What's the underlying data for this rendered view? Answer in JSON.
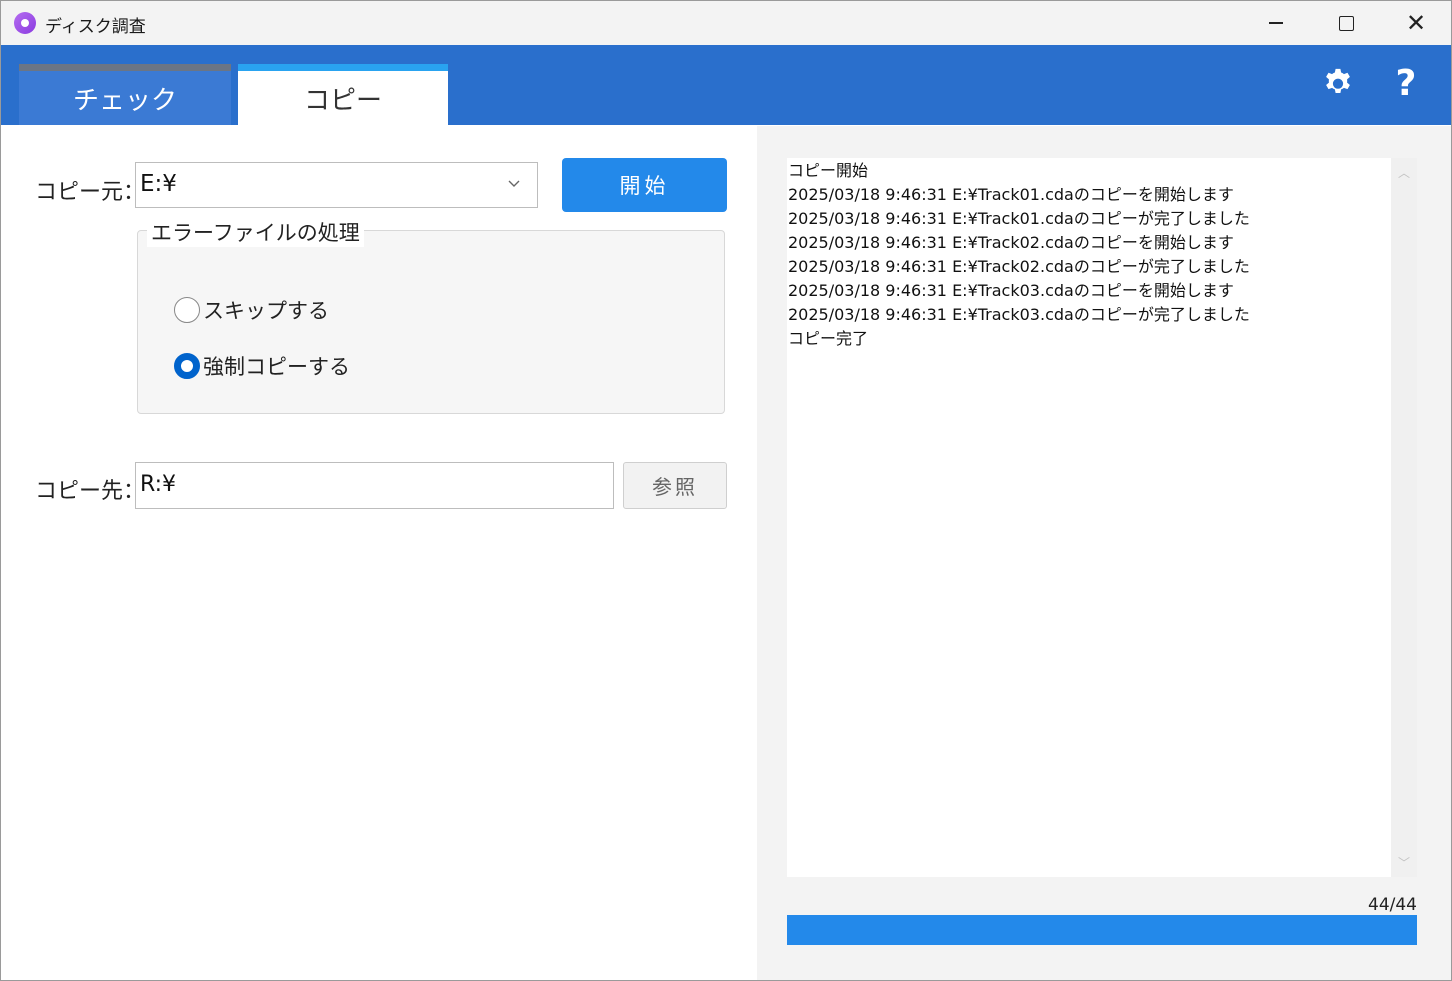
{
  "window": {
    "title": "ディスク調査",
    "icon": "app-disc-icon",
    "controls": [
      "minimize-icon",
      "maximize-icon",
      "close-icon"
    ]
  },
  "tabs": [
    {
      "label": "チェック",
      "active": false
    },
    {
      "label": "コピー",
      "active": true
    }
  ],
  "header_icons": {
    "settings": "gear-icon",
    "help_label": "?"
  },
  "copy": {
    "source_label": "コピー元：",
    "source_value": "E:¥",
    "start_button": "開始",
    "error_group_title": "エラーファイルの処理",
    "options": [
      {
        "label": "スキップする",
        "selected": false
      },
      {
        "label": "強制コピーする",
        "selected": true
      }
    ],
    "dest_label": "コピー先：",
    "dest_value": "R:¥",
    "browse_button": "参照"
  },
  "log": {
    "lines": [
      "コピー開始",
      "2025/03/18 9:46:31 E:¥Track01.cdaのコピーを開始します",
      "2025/03/18 9:46:31 E:¥Track01.cdaのコピーが完了しました",
      "2025/03/18 9:46:31 E:¥Track02.cdaのコピーを開始します",
      "2025/03/18 9:46:31 E:¥Track02.cdaのコピーが完了しました",
      "2025/03/18 9:46:31 E:¥Track03.cdaのコピーを開始します",
      "2025/03/18 9:46:31 E:¥Track03.cdaのコピーが完了しました",
      "コピー完了"
    ]
  },
  "progress": {
    "count_text": "44/44",
    "fraction": 1.0
  },
  "colors": {
    "header": "#2a6fcc",
    "accent": "#2389ea",
    "active_tab_bar": "#29a3f0"
  }
}
